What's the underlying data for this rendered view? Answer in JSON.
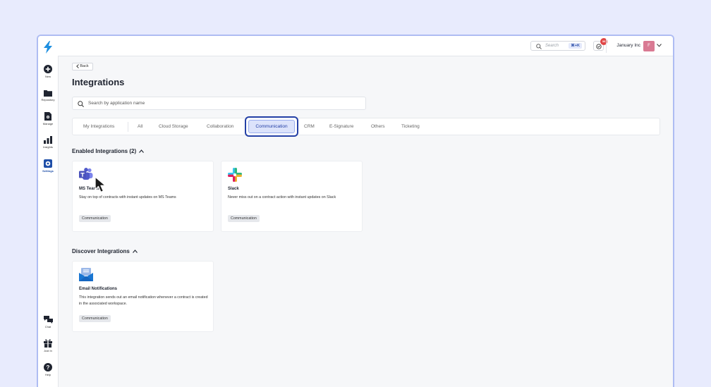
{
  "sidebar": {
    "items": [
      {
        "label": "New",
        "icon": "plus-circle-icon"
      },
      {
        "label": "Repository",
        "icon": "folder-icon"
      },
      {
        "label": "Manage",
        "icon": "document-gear-icon"
      },
      {
        "label": "Insights",
        "icon": "bar-chart-icon"
      },
      {
        "label": "Settings",
        "icon": "gear-icon",
        "active": true
      }
    ],
    "bottom_items": [
      {
        "label": "Chat",
        "icon": "chat-icon"
      },
      {
        "label": "Just In",
        "icon": "gift-icon"
      },
      {
        "label": "Help",
        "icon": "help-icon"
      }
    ]
  },
  "topbar": {
    "search_placeholder": "Search",
    "search_shortcut": "⌘+K",
    "notification_count": "30",
    "org_name": "January Inc",
    "avatar_initial": "F"
  },
  "page": {
    "back_label": "Back",
    "title": "Integrations",
    "search_placeholder": "Search by application name"
  },
  "tabs": [
    {
      "label": "My Integrations"
    },
    {
      "label": "All"
    },
    {
      "label": "Cloud Storage"
    },
    {
      "label": "Collaboration"
    },
    {
      "label": "Communication",
      "active": true
    },
    {
      "label": "CRM"
    },
    {
      "label": "E-Signature"
    },
    {
      "label": "Others"
    },
    {
      "label": "Ticketing"
    }
  ],
  "enabled": {
    "heading": "Enabled Integrations (2)",
    "cards": [
      {
        "name": "MS Teams",
        "description": "Stay on top of contracts with instant updates on MS Teams",
        "tag": "Communication",
        "icon": "ms-teams-icon"
      },
      {
        "name": "Slack",
        "description": "Never miss out on a contract action with instant updates on Slack",
        "tag": "Communication",
        "icon": "slack-icon"
      }
    ]
  },
  "discover": {
    "heading": "Discover Integrations",
    "cards": [
      {
        "name": "Email Notifications",
        "description": "This integration sends out an email notification whenever a contract is created in the associated workspace.",
        "tag": "Communication",
        "icon": "email-icon"
      }
    ]
  },
  "colors": {
    "accent": "#2440a6",
    "background": "#e8ebfd",
    "badge": "#e04545",
    "avatar": "#d97a93"
  }
}
